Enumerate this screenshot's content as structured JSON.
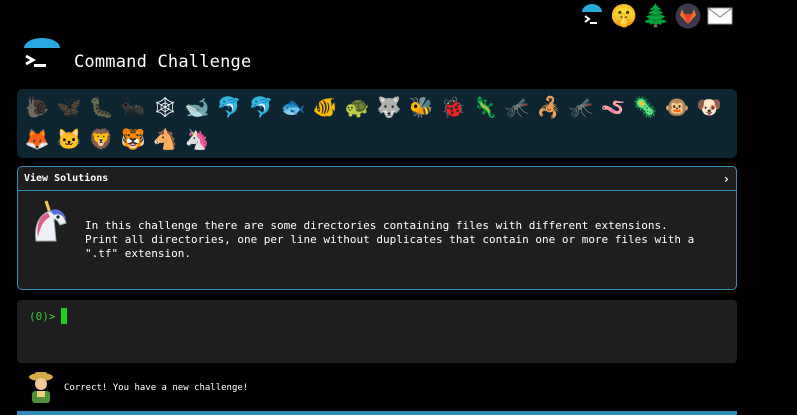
{
  "header": {
    "title": "Command Challenge",
    "top_icons": [
      {
        "name": "terminal-logo-icon"
      },
      {
        "name": "shushing-face-icon",
        "glyph": "🤫"
      },
      {
        "name": "tree-icon",
        "glyph": "🌲"
      },
      {
        "name": "gitlab-icon"
      },
      {
        "name": "mail-icon",
        "glyph": "✉"
      }
    ]
  },
  "animals": {
    "row1": [
      "🐌",
      "🦋",
      "🐛",
      "🐜",
      "🕸",
      "🐋",
      "🐬",
      "🐬",
      "🐟",
      "🐠",
      "🐢",
      "🐺",
      "🐝",
      "🐞",
      "🦎",
      "🦟",
      "🦂",
      "🦟",
      "🪱",
      "🦠",
      "🐵",
      "🐶"
    ],
    "row2": [
      "🦊",
      "🐱",
      "🦁",
      "🐯",
      "🐴",
      "🦄"
    ]
  },
  "solutions": {
    "header": "View Solutions",
    "chevron": "›",
    "description": "In this challenge there are some directories containing files with different extensions.\nPrint all directories, one per line without duplicates that contain one or more files with a\n\".tf\" extension."
  },
  "terminal": {
    "prompt": "(0)>"
  },
  "status": {
    "message": "Correct! You have a new challenge!"
  },
  "colors": {
    "accent": "#2f8db8",
    "prompt_green": "#39c839",
    "panel_bg": "#1e1e1e",
    "animal_strip_bg": "#0c2530"
  }
}
